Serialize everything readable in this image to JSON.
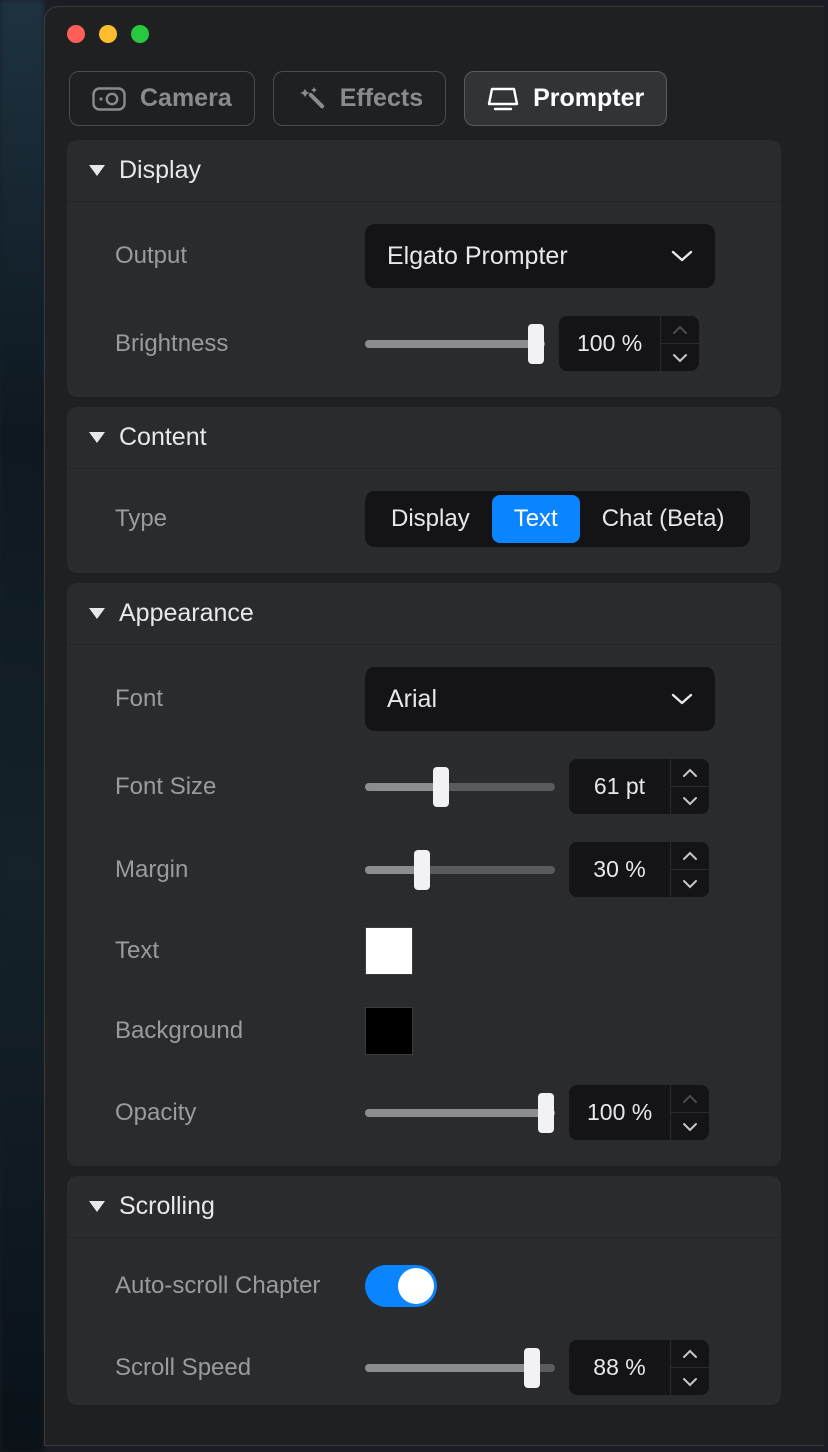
{
  "tabs": {
    "camera": "Camera",
    "effects": "Effects",
    "prompter": "Prompter"
  },
  "sections": {
    "display": {
      "title": "Display",
      "output_label": "Output",
      "output_value": "Elgato Prompter",
      "brightness_label": "Brightness",
      "brightness_value": "100 %",
      "brightness_percent": 100
    },
    "content": {
      "title": "Content",
      "type_label": "Type",
      "segments": {
        "display": "Display",
        "text": "Text",
        "chat": "Chat (Beta)"
      },
      "active": "text"
    },
    "appearance": {
      "title": "Appearance",
      "font_label": "Font",
      "font_value": "Arial",
      "font_size_label": "Font Size",
      "font_size_value": "61 pt",
      "font_size_percent": 40,
      "margin_label": "Margin",
      "margin_value": "30 %",
      "margin_percent": 30,
      "text_label": "Text",
      "text_color": "#ffffff",
      "background_label": "Background",
      "background_color": "#000000",
      "opacity_label": "Opacity",
      "opacity_value": "100 %",
      "opacity_percent": 100
    },
    "scrolling": {
      "title": "Scrolling",
      "autoscroll_label": "Auto-scroll Chapter",
      "autoscroll_on": true,
      "speed_label": "Scroll Speed",
      "speed_value": "88 %",
      "speed_percent": 88
    }
  }
}
